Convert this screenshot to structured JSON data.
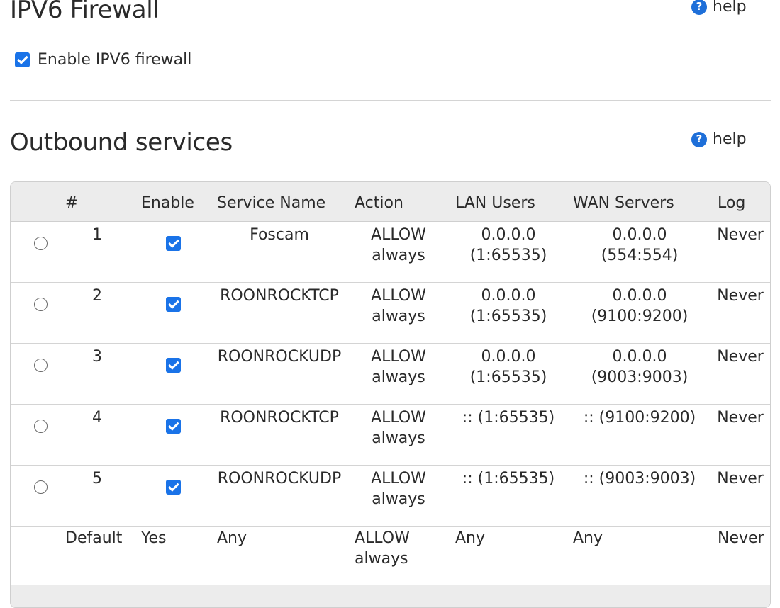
{
  "firewall": {
    "title": "IPV6 Firewall",
    "help_label": "help",
    "enable_label": "Enable IPV6 firewall",
    "enabled": true
  },
  "outbound": {
    "title": "Outbound services",
    "help_label": "help",
    "columns": [
      "#",
      "Enable",
      "Service Name",
      "Action",
      "LAN Users",
      "WAN Servers",
      "Log"
    ],
    "rows": [
      {
        "num": "1",
        "enabled": true,
        "service": "Foscam",
        "action": "ALLOW\nalways",
        "lan": "0.0.0.0\n(1:65535)",
        "wan": "0.0.0.0\n(554:554)",
        "log": "Never"
      },
      {
        "num": "2",
        "enabled": true,
        "service": "ROONROCKTCP",
        "action": "ALLOW\nalways",
        "lan": "0.0.0.0\n(1:65535)",
        "wan": "0.0.0.0\n(9100:9200)",
        "log": "Never"
      },
      {
        "num": "3",
        "enabled": true,
        "service": "ROONROCKUDP",
        "action": "ALLOW\nalways",
        "lan": "0.0.0.0\n(1:65535)",
        "wan": "0.0.0.0\n(9003:9003)",
        "log": "Never"
      },
      {
        "num": "4",
        "enabled": true,
        "service": "ROONROCKTCP",
        "action": "ALLOW\nalways",
        "lan": ":: (1:65535)",
        "wan": ":: (9100:9200)",
        "log": "Never"
      },
      {
        "num": "5",
        "enabled": true,
        "service": "ROONROCKUDP",
        "action": "ALLOW\nalways",
        "lan": ":: (1:65535)",
        "wan": ":: (9003:9003)",
        "log": "Never"
      }
    ],
    "default_row": {
      "label": "Default",
      "enable": "Yes",
      "service": "Any",
      "action": "ALLOW\nalways",
      "lan": "Any",
      "wan": "Any",
      "log": "Never"
    }
  }
}
